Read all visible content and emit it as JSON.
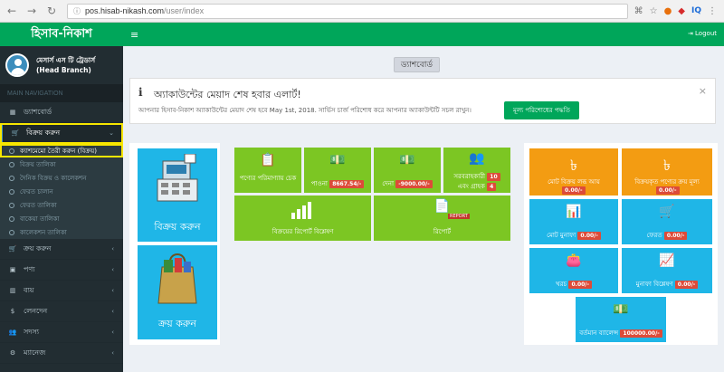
{
  "browser": {
    "url_host": "pos.hisab-nikash.com",
    "url_path": "/user/index",
    "ext_iq": "IQ"
  },
  "sidebar": {
    "logo": "হিসাব-নিকাশ",
    "user_name": "মেসার্স এস টি ট্রেডার্স",
    "user_branch": "(Head Branch)",
    "nav_header": "MAIN NAVIGATION",
    "dashboard": "ড্যাশবোর্ড",
    "sell": "বিক্রয় করুন",
    "sub_items": [
      "ক্যাশমেমো তৈরী করুন (বিক্রয়)",
      "বিক্রয় তালিকা",
      "দৈনিক বিক্রয় ও কালেকশন",
      "ফেরত চালান",
      "ফেরত তালিকা",
      "বাকেয়া তালিকা",
      "কালেকশন তালিকা"
    ],
    "menu_items": [
      "ক্রয় করুন",
      "পণ্য",
      "ব্যয়",
      "লেনদেন",
      "সদস্য",
      "ম্যানেজ"
    ]
  },
  "topbar": {
    "logout": "Logout"
  },
  "content": {
    "page_title": "ড্যাশবোর্ড",
    "alert_title": "অ্যাকাউন্টের মেয়াদ শেষ হবার এলার্ট!",
    "alert_msg": "আপনার হিসাব-নিকাশ অ্যাকাউন্টের মেয়াদ শেষ হবে May 1st, 2018. সার্ভিস চার্জ পরিশোধ করে আপনার অ্যাকাউন্টটি সচল রাখুন।",
    "alert_button": "মূল্য পরিশোধের পদ্ধতি",
    "alert_close": "×"
  },
  "tiles": {
    "sell_big": "বিক্রয় করুন",
    "buy_big": "ক্রয় করুন",
    "product_check": "পণ্যের পরিমাণ্যায় চেক",
    "receivable": "পাওনা",
    "receivable_value": "8667.54/-",
    "payable": "দেনা",
    "payable_value": "-9000.00/-",
    "supplier": "সরবরাহকারী",
    "supplier_count": "10",
    "and": "এবং গ্রাহক",
    "customer_count": "4",
    "sales_report_analysis": "বিক্রয়ের রিপোর্ট বিশ্লেষণ",
    "report": "রিপোর্ট",
    "report_badge": "REPORT",
    "total_sales_income": "মোট বিক্রয় লব্ধ আয়",
    "total_sales_income_value": "0.00/-",
    "sold_goods_cost": "বিক্রয়কৃত পণ্যের ক্রয় মূল্য",
    "sold_goods_cost_value": "0.00/-",
    "total_profit": "মোট মুনাফা",
    "total_profit_value": "0.00/-",
    "returns": "ফেরত",
    "returns_value": "0.00/-",
    "expense": "খরচ",
    "expense_value": "0.00/-",
    "profit_analysis": "মুনাফা বিশ্লেষণ",
    "profit_analysis_value": "0.00/-",
    "current_balance": "বর্তমান ব্যালেন্স",
    "current_balance_value": "100000.00/-"
  },
  "colors": {
    "green_header": "#00a65a",
    "sidebar_bg": "#222d32",
    "tile_green": "#7cc623",
    "tile_blue": "#1fb6e7",
    "tile_orange": "#f39c12",
    "highlight_yellow": "#f7e600"
  }
}
